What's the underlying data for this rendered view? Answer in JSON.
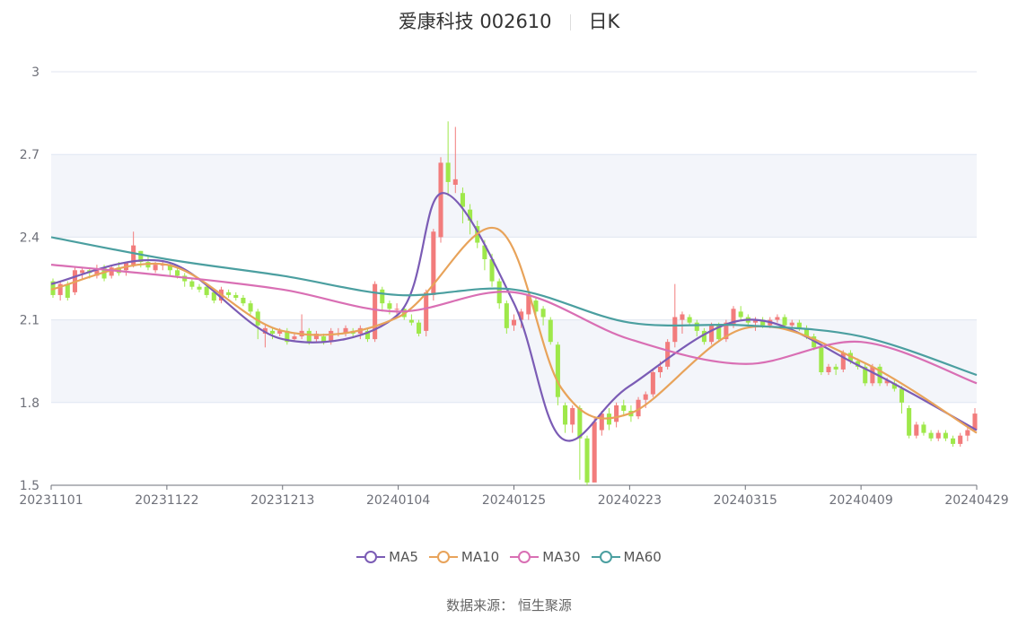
{
  "header": {
    "name_code": "爱康科技 002610",
    "period": "日K"
  },
  "source": "数据来源：  恒生聚源",
  "chart_data": {
    "type": "candlestick",
    "title": "爱康科技 002610",
    "subtitle": "日K",
    "ylim": [
      1.5,
      3.0
    ],
    "yticks": [
      "3",
      "2.7",
      "2.4",
      "2.1",
      "1.8",
      "1.5"
    ],
    "xticks": [
      "20231101",
      "20231122",
      "20231213",
      "20240104",
      "20240125",
      "20240223",
      "20240315",
      "20240409",
      "20240429"
    ],
    "grid": true,
    "legend_position": "bottom",
    "colors": {
      "up": "#f27c7c",
      "down": "#9ee84a",
      "MA5": "#7b5cb5",
      "MA10": "#e8a35a",
      "MA30": "#d96fb4",
      "MA60": "#4b9fa0",
      "grid_band": "#f3f5fa"
    },
    "series": [
      {
        "name": "MA5",
        "x": [
          "20231101",
          "20231122",
          "20231213",
          "20240104",
          "20240112",
          "20240125",
          "20240206",
          "20240223",
          "20240315",
          "20240409",
          "20240429"
        ],
        "values": [
          2.23,
          2.31,
          2.03,
          2.12,
          2.56,
          2.16,
          1.67,
          1.86,
          2.1,
          1.93,
          1.7
        ]
      },
      {
        "name": "MA10",
        "x": [
          "20231101",
          "20231122",
          "20231213",
          "20240104",
          "20240122",
          "20240206",
          "20240223",
          "20240315",
          "20240409",
          "20240429"
        ],
        "values": [
          2.21,
          2.3,
          2.06,
          2.11,
          2.43,
          1.85,
          1.76,
          2.07,
          1.95,
          1.69
        ]
      },
      {
        "name": "MA30",
        "x": [
          "20231101",
          "20231122",
          "20231213",
          "20240104",
          "20240125",
          "20240223",
          "20240315",
          "20240409",
          "20240429"
        ],
        "values": [
          2.3,
          2.26,
          2.21,
          2.13,
          2.2,
          2.03,
          1.94,
          2.02,
          1.87
        ]
      },
      {
        "name": "MA60",
        "x": [
          "20231101",
          "20231122",
          "20231213",
          "20240104",
          "20240125",
          "20240223",
          "20240315",
          "20240409",
          "20240429"
        ],
        "values": [
          2.4,
          2.32,
          2.26,
          2.19,
          2.21,
          2.09,
          2.08,
          2.04,
          1.9
        ]
      }
    ],
    "candles": [
      [
        2.24,
        2.19,
        2.25,
        2.18
      ],
      [
        2.19,
        2.23,
        2.24,
        2.17
      ],
      [
        2.23,
        2.18,
        2.24,
        2.17
      ],
      [
        2.2,
        2.28,
        2.29,
        2.19
      ],
      [
        2.27,
        2.28,
        2.29,
        2.25
      ],
      [
        2.28,
        2.27,
        2.29,
        2.25
      ],
      [
        2.26,
        2.28,
        2.3,
        2.25
      ],
      [
        2.29,
        2.25,
        2.3,
        2.24
      ],
      [
        2.26,
        2.29,
        2.3,
        2.25
      ],
      [
        2.29,
        2.27,
        2.31,
        2.26
      ],
      [
        2.28,
        2.31,
        2.31,
        2.26
      ],
      [
        2.3,
        2.37,
        2.42,
        2.29
      ],
      [
        2.35,
        2.31,
        2.35,
        2.29
      ],
      [
        2.31,
        2.29,
        2.33,
        2.28
      ],
      [
        2.28,
        2.3,
        2.31,
        2.27
      ],
      [
        2.3,
        2.3,
        2.31,
        2.28
      ],
      [
        2.3,
        2.28,
        2.31,
        2.26
      ],
      [
        2.28,
        2.26,
        2.29,
        2.25
      ],
      [
        2.26,
        2.24,
        2.27,
        2.22
      ],
      [
        2.24,
        2.22,
        2.25,
        2.21
      ],
      [
        2.22,
        2.21,
        2.23,
        2.2
      ],
      [
        2.22,
        2.19,
        2.23,
        2.18
      ],
      [
        2.2,
        2.17,
        2.21,
        2.16
      ],
      [
        2.17,
        2.21,
        2.22,
        2.16
      ],
      [
        2.2,
        2.19,
        2.21,
        2.18
      ],
      [
        2.19,
        2.18,
        2.2,
        2.17
      ],
      [
        2.18,
        2.16,
        2.19,
        2.15
      ],
      [
        2.16,
        2.13,
        2.17,
        2.12
      ],
      [
        2.13,
        2.08,
        2.14,
        2.03
      ],
      [
        2.05,
        2.07,
        2.08,
        2.0
      ],
      [
        2.06,
        2.05,
        2.07,
        2.03
      ],
      [
        2.05,
        2.06,
        2.07,
        2.04
      ],
      [
        2.06,
        2.02,
        2.07,
        2.01
      ],
      [
        2.03,
        2.04,
        2.05,
        2.02
      ],
      [
        2.04,
        2.06,
        2.12,
        2.03
      ],
      [
        2.06,
        2.02,
        2.07,
        2.01
      ],
      [
        2.03,
        2.05,
        2.06,
        2.02
      ],
      [
        2.04,
        2.02,
        2.05,
        2.01
      ],
      [
        2.02,
        2.06,
        2.07,
        2.01
      ],
      [
        2.05,
        2.05,
        2.07,
        2.04
      ],
      [
        2.05,
        2.07,
        2.08,
        2.04
      ],
      [
        2.06,
        2.05,
        2.07,
        2.04
      ],
      [
        2.05,
        2.07,
        2.08,
        2.03
      ],
      [
        2.06,
        2.03,
        2.07,
        2.02
      ],
      [
        2.03,
        2.23,
        2.24,
        2.02
      ],
      [
        2.21,
        2.16,
        2.22,
        2.13
      ],
      [
        2.16,
        2.14,
        2.17,
        2.12
      ],
      [
        2.14,
        2.14,
        2.16,
        2.12
      ],
      [
        2.14,
        2.11,
        2.15,
        2.1
      ],
      [
        2.1,
        2.09,
        2.12,
        2.08
      ],
      [
        2.09,
        2.05,
        2.1,
        2.04
      ],
      [
        2.06,
        2.2,
        2.21,
        2.04
      ],
      [
        2.19,
        2.42,
        2.43,
        2.17
      ],
      [
        2.4,
        2.67,
        2.69,
        2.38
      ],
      [
        2.67,
        2.6,
        2.82,
        2.55
      ],
      [
        2.59,
        2.61,
        2.8,
        2.56
      ],
      [
        2.56,
        2.51,
        2.58,
        2.45
      ],
      [
        2.5,
        2.46,
        2.52,
        2.41
      ],
      [
        2.44,
        2.38,
        2.46,
        2.36
      ],
      [
        2.37,
        2.32,
        2.39,
        2.28
      ],
      [
        2.32,
        2.24,
        2.34,
        2.22
      ],
      [
        2.24,
        2.16,
        2.25,
        2.14
      ],
      [
        2.16,
        2.07,
        2.17,
        2.05
      ],
      [
        2.08,
        2.1,
        2.12,
        2.06
      ],
      [
        2.1,
        2.13,
        2.14,
        2.07
      ],
      [
        2.12,
        2.19,
        2.2,
        2.1
      ],
      [
        2.17,
        2.13,
        2.18,
        2.11
      ],
      [
        2.14,
        2.11,
        2.15,
        2.08
      ],
      [
        2.1,
        2.02,
        2.11,
        2.01
      ],
      [
        2.01,
        1.82,
        2.02,
        1.79
      ],
      [
        1.79,
        1.72,
        1.8,
        1.69
      ],
      [
        1.72,
        1.78,
        1.79,
        1.69
      ],
      [
        1.78,
        1.67,
        1.79,
        1.52
      ],
      [
        1.67,
        1.51,
        1.68,
        1.5
      ],
      [
        1.51,
        1.73,
        1.75,
        1.52
      ],
      [
        1.7,
        1.76,
        1.77,
        1.68
      ],
      [
        1.76,
        1.72,
        1.78,
        1.7
      ],
      [
        1.73,
        1.79,
        1.8,
        1.71
      ],
      [
        1.79,
        1.77,
        1.81,
        1.75
      ],
      [
        1.77,
        1.75,
        1.79,
        1.73
      ],
      [
        1.75,
        1.81,
        1.82,
        1.74
      ],
      [
        1.81,
        1.83,
        1.84,
        1.78
      ],
      [
        1.83,
        1.91,
        1.92,
        1.82
      ],
      [
        1.91,
        1.93,
        1.95,
        1.89
      ],
      [
        1.93,
        2.02,
        2.03,
        1.92
      ],
      [
        2.02,
        2.11,
        2.23,
        2.0
      ],
      [
        2.1,
        2.12,
        2.13,
        2.05
      ],
      [
        2.11,
        2.09,
        2.12,
        2.08
      ],
      [
        2.09,
        2.06,
        2.1,
        2.04
      ],
      [
        2.06,
        2.02,
        2.07,
        2.01
      ],
      [
        2.02,
        2.08,
        2.09,
        2.01
      ],
      [
        2.08,
        2.03,
        2.09,
        2.02
      ],
      [
        2.03,
        2.09,
        2.1,
        2.02
      ],
      [
        2.08,
        2.14,
        2.15,
        2.07
      ],
      [
        2.13,
        2.11,
        2.15,
        2.1
      ],
      [
        2.11,
        2.09,
        2.12,
        2.08
      ],
      [
        2.09,
        2.1,
        2.11,
        2.06
      ],
      [
        2.1,
        2.08,
        2.11,
        2.07
      ],
      [
        2.08,
        2.1,
        2.11,
        2.07
      ],
      [
        2.1,
        2.11,
        2.12,
        2.09
      ],
      [
        2.11,
        2.08,
        2.12,
        2.07
      ],
      [
        2.08,
        2.09,
        2.1,
        2.07
      ],
      [
        2.09,
        2.07,
        2.1,
        2.06
      ],
      [
        2.07,
        2.04,
        2.08,
        2.03
      ],
      [
        2.04,
        2.0,
        2.05,
        1.99
      ],
      [
        2.0,
        1.91,
        2.01,
        1.9
      ],
      [
        1.91,
        1.93,
        1.94,
        1.9
      ],
      [
        1.93,
        1.92,
        1.94,
        1.9
      ],
      [
        1.92,
        1.98,
        1.99,
        1.91
      ],
      [
        1.98,
        1.95,
        1.99,
        1.94
      ],
      [
        1.95,
        1.93,
        1.96,
        1.92
      ],
      [
        1.93,
        1.87,
        1.94,
        1.86
      ],
      [
        1.87,
        1.93,
        1.94,
        1.86
      ],
      [
        1.93,
        1.87,
        1.94,
        1.86
      ],
      [
        1.87,
        1.88,
        1.89,
        1.86
      ],
      [
        1.87,
        1.85,
        1.88,
        1.84
      ],
      [
        1.85,
        1.8,
        1.86,
        1.76
      ],
      [
        1.78,
        1.68,
        1.79,
        1.67
      ],
      [
        1.68,
        1.72,
        1.73,
        1.67
      ],
      [
        1.72,
        1.69,
        1.73,
        1.68
      ],
      [
        1.69,
        1.67,
        1.7,
        1.66
      ],
      [
        1.67,
        1.69,
        1.7,
        1.66
      ],
      [
        1.69,
        1.67,
        1.7,
        1.66
      ],
      [
        1.67,
        1.65,
        1.68,
        1.64
      ],
      [
        1.65,
        1.68,
        1.69,
        1.64
      ],
      [
        1.68,
        1.7,
        1.71,
        1.66
      ],
      [
        1.7,
        1.76,
        1.78,
        1.69
      ]
    ]
  }
}
